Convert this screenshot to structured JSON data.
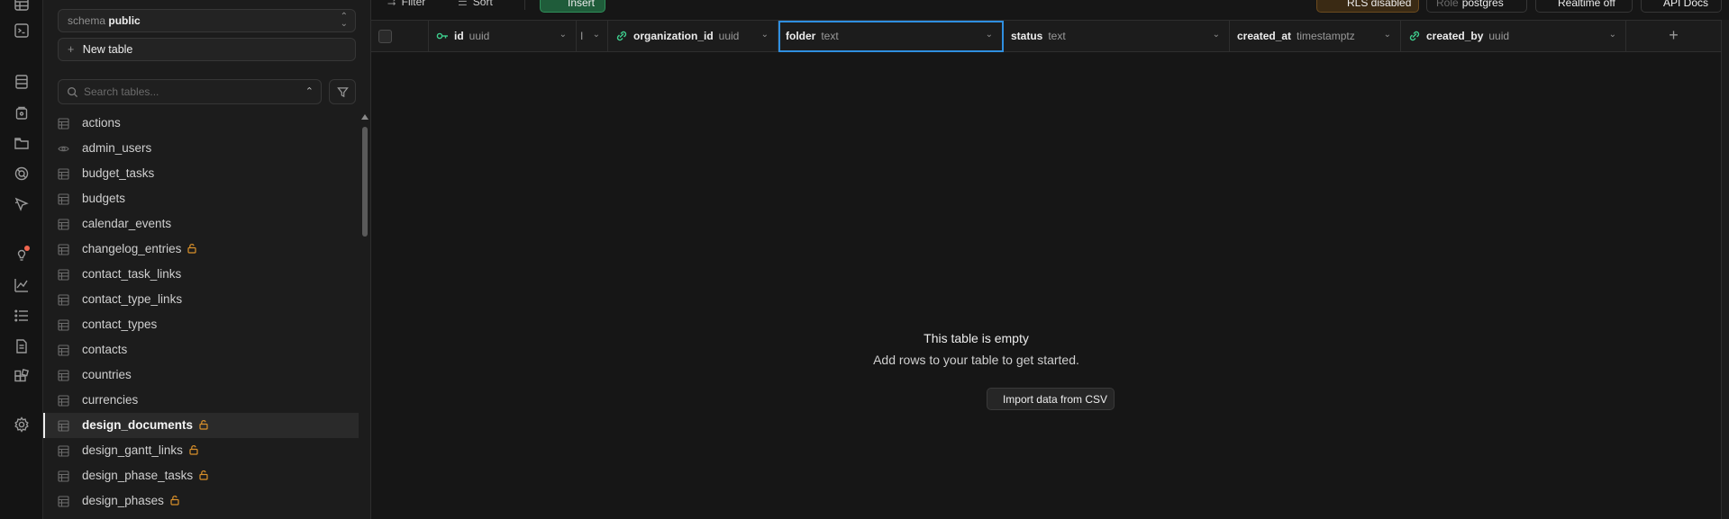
{
  "rail": {
    "icons": [
      "table-editor-icon",
      "sql-editor-icon",
      "database-icon",
      "auth-icon",
      "storage-icon",
      "realtime-icon",
      "edge-functions-icon",
      "advisors-icon",
      "reports-icon",
      "logs-icon",
      "api-docs-icon",
      "integrations-icon",
      "settings-icon"
    ]
  },
  "sidebar": {
    "schema_label": "schema",
    "schema_value": "public",
    "new_table_label": "New table",
    "search_placeholder": "Search tables...",
    "tables": [
      {
        "name": "actions",
        "locked": false,
        "view": false
      },
      {
        "name": "admin_users",
        "locked": false,
        "view": true
      },
      {
        "name": "budget_tasks",
        "locked": false,
        "view": false
      },
      {
        "name": "budgets",
        "locked": false,
        "view": false
      },
      {
        "name": "calendar_events",
        "locked": false,
        "view": false
      },
      {
        "name": "changelog_entries",
        "locked": true,
        "view": false
      },
      {
        "name": "contact_task_links",
        "locked": false,
        "view": false
      },
      {
        "name": "contact_type_links",
        "locked": false,
        "view": false
      },
      {
        "name": "contact_types",
        "locked": false,
        "view": false
      },
      {
        "name": "contacts",
        "locked": false,
        "view": false
      },
      {
        "name": "countries",
        "locked": false,
        "view": false
      },
      {
        "name": "currencies",
        "locked": false,
        "view": false
      },
      {
        "name": "design_documents",
        "locked": true,
        "view": false,
        "active": true
      },
      {
        "name": "design_gantt_links",
        "locked": true,
        "view": false
      },
      {
        "name": "design_phase_tasks",
        "locked": true,
        "view": false
      },
      {
        "name": "design_phases",
        "locked": true,
        "view": false
      }
    ]
  },
  "toolbar": {
    "filter_label": "Filter",
    "sort_label": "Sort",
    "insert_label": "Insert",
    "rls_label": "RLS disabled",
    "role_key": "Role",
    "role_value": "postgres",
    "realtime_label": "Realtime off",
    "api_docs_label": "API Docs"
  },
  "columns": [
    {
      "name": "id",
      "type": "uuid",
      "icon": "key-icon"
    },
    {
      "name": "I",
      "type": "",
      "icon": ""
    },
    {
      "name": "organization_id",
      "type": "uuid",
      "icon": "link-icon"
    },
    {
      "name": "folder",
      "type": "text",
      "icon": ""
    },
    {
      "name": "status",
      "type": "text",
      "icon": ""
    },
    {
      "name": "created_at",
      "type": "timestamptz",
      "icon": ""
    },
    {
      "name": "created_by",
      "type": "uuid",
      "icon": "link-icon"
    }
  ],
  "add_column_label": "+",
  "empty_state": {
    "title": "This table is empty",
    "subtitle": "Add rows to your table to get started.",
    "import_button": "Import data from CSV"
  }
}
